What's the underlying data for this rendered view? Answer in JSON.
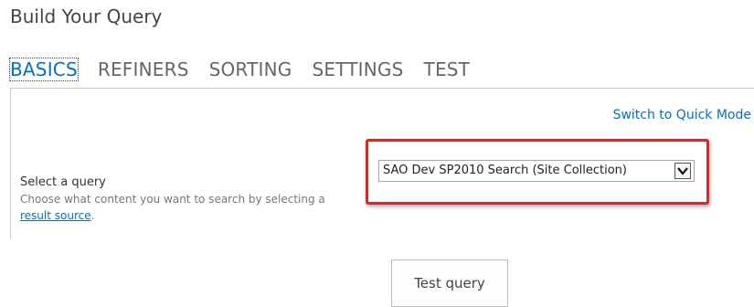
{
  "dialog": {
    "title": "Build Your Query"
  },
  "tabs": [
    {
      "label": "BASICS",
      "active": true
    },
    {
      "label": "REFINERS",
      "active": false
    },
    {
      "label": "SORTING",
      "active": false
    },
    {
      "label": "SETTINGS",
      "active": false
    },
    {
      "label": "TEST",
      "active": false
    }
  ],
  "basics": {
    "switch_mode_link": "Switch to Quick Mode",
    "select_query": {
      "label": "Select a query",
      "description_prefix": "Choose what content you want to search by selecting a ",
      "description_link": "result source",
      "description_suffix": ".",
      "selected_value": "SAO Dev SP2010 Search (Site Collection)"
    },
    "test_button": "Test query"
  },
  "colors": {
    "accent": "#0072c6",
    "highlight_border": "#d92a2a",
    "text": "#444444"
  },
  "icons": {
    "dropdown": "chevron-down-icon"
  }
}
